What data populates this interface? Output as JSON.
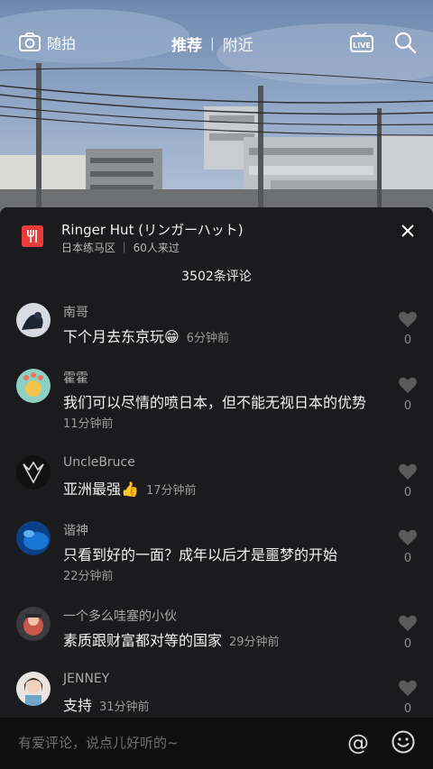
{
  "topbar": {
    "camera_label": "随拍",
    "tab_recommend": "推荐",
    "tab_nearby": "附近",
    "separator": "|"
  },
  "poi": {
    "name": "Ringer Hut (リンガーハット)",
    "subtitle": "日本练马区 ｜ 60人来过"
  },
  "comment_count": "3502条评论",
  "comments": [
    {
      "user": "南哥",
      "text": "下个月去东京玩😁",
      "time": "6分钟前",
      "likes": "0"
    },
    {
      "user": "霍霍",
      "text": "我们可以尽情的喷日本，但不能无视日本的优势",
      "time": "11分钟前",
      "likes": "0"
    },
    {
      "user": "UncleBruce",
      "text": "亚洲最强👍",
      "time": "17分钟前",
      "likes": "0"
    },
    {
      "user": "谐神",
      "text": "只看到好的一面？成年以后才是噩梦的开始",
      "time": "22分钟前",
      "likes": "0"
    },
    {
      "user": "一个多么哇塞的小伙",
      "text": "素质跟财富都对等的国家",
      "time": "29分钟前",
      "likes": "0"
    },
    {
      "user": "JENNEY",
      "text": "支持",
      "time": "31分钟前",
      "likes": "0"
    }
  ],
  "input": {
    "placeholder": "有爱评论，说点儿好听的~",
    "at_symbol": "@"
  },
  "icons": {
    "camera": "camera-icon",
    "live": "live-tv-icon",
    "search": "search-icon",
    "poi": "restaurant-fork-icon",
    "close": "close-icon",
    "like": "heart-icon",
    "emoji": "emoji-smile-icon"
  },
  "colors": {
    "sheet_bg": "#1b1b1d",
    "input_bg": "#0f0f10",
    "poi_badge": "#ea3a3a",
    "like_icon": "#5b5b5b"
  }
}
